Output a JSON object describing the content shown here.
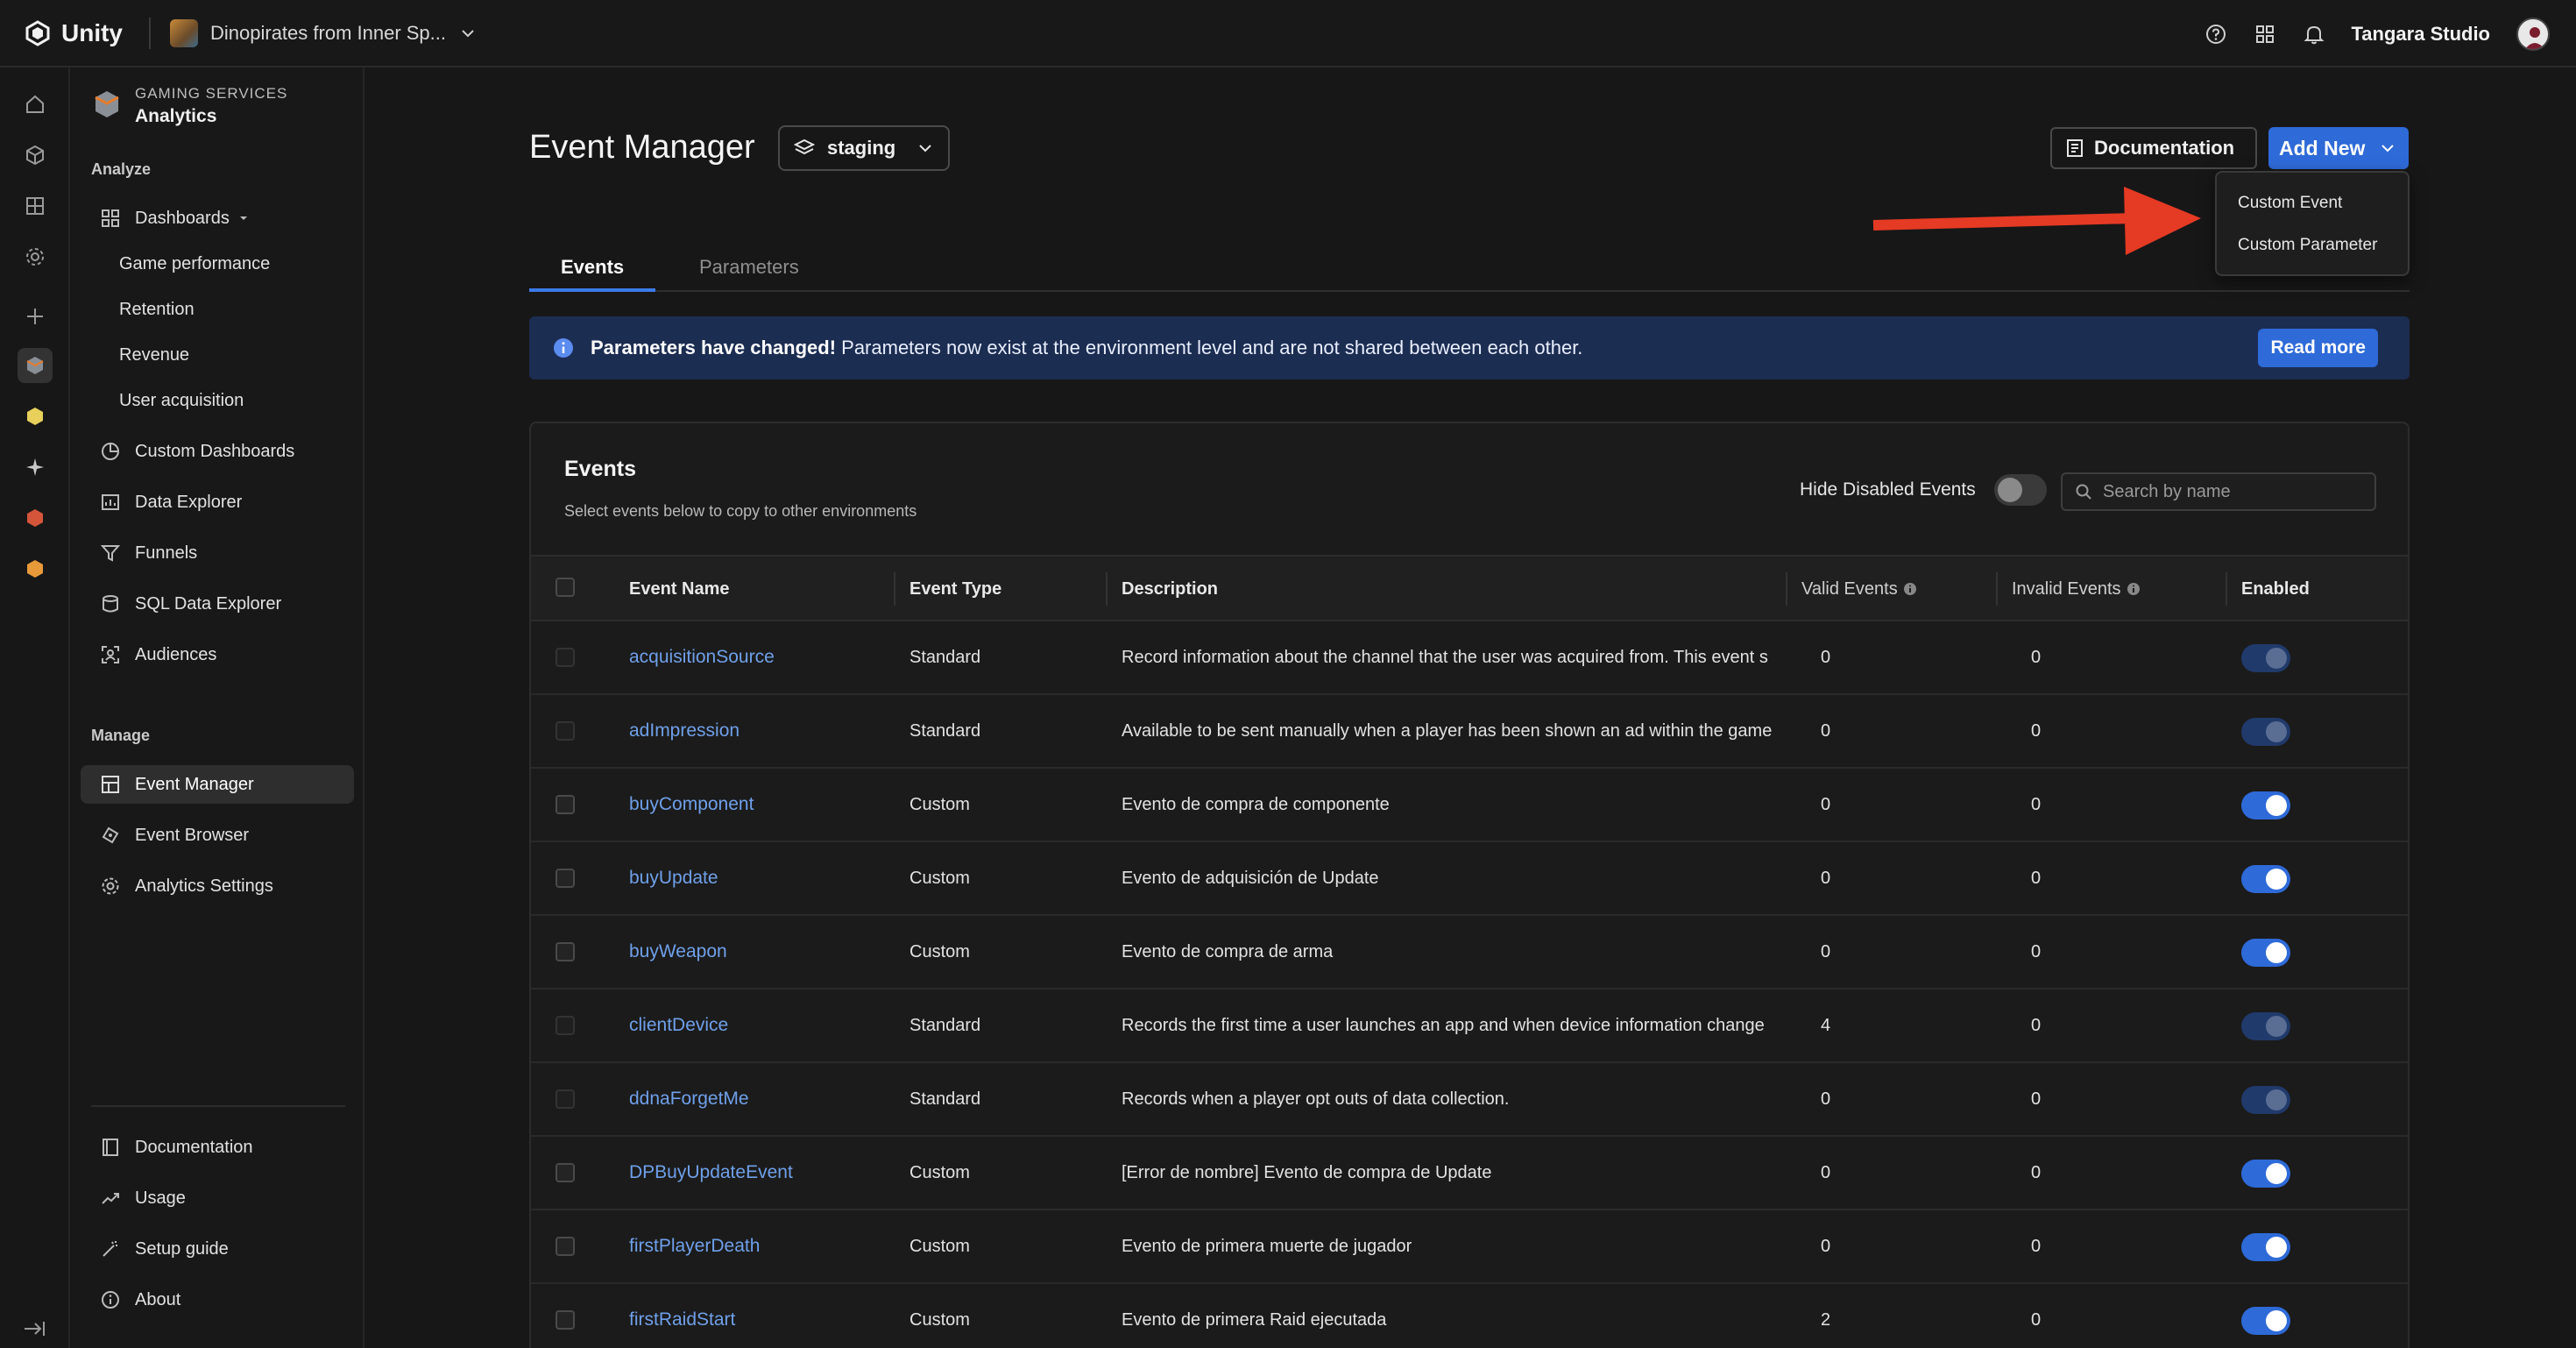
{
  "topbar": {
    "brand": "Unity",
    "project": "Dinopirates from Inner Sp...",
    "org": "Tangara Studio",
    "icons": [
      "help-icon",
      "apps-grid-icon",
      "bell-icon"
    ]
  },
  "sidebar": {
    "service_kicker": "GAMING SERVICES",
    "service_title": "Analytics",
    "analyze_label": "Analyze",
    "manage_label": "Manage",
    "dashboards": "Dashboards",
    "dashboard_items": [
      "Game performance",
      "Retention",
      "Revenue",
      "User acquisition"
    ],
    "analyze_items": [
      "Custom Dashboards",
      "Data Explorer",
      "Funnels",
      "SQL Data Explorer",
      "Audiences"
    ],
    "manage_items": [
      "Event Manager",
      "Event Browser",
      "Analytics Settings"
    ],
    "footer_items": [
      "Documentation",
      "Usage",
      "Setup guide",
      "About"
    ]
  },
  "header": {
    "title": "Event Manager",
    "environment": "staging",
    "documentation_label": "Documentation",
    "add_new_label": "Add New"
  },
  "add_menu": {
    "items": [
      "Custom Event",
      "Custom Parameter"
    ]
  },
  "tabs": [
    "Events",
    "Parameters"
  ],
  "banner": {
    "bold": "Parameters have changed!",
    "text": " Parameters now exist at the environment level and are not shared between each other.",
    "action": "Read more"
  },
  "events_card": {
    "title": "Events",
    "subtitle": "Select events below to copy to other environments",
    "hide_disabled_label": "Hide Disabled Events",
    "hide_disabled_on": false,
    "search_placeholder": "Search by name"
  },
  "table": {
    "columns": [
      "Event Name",
      "Event Type",
      "Description",
      "Valid Events",
      "Invalid Events",
      "Enabled"
    ],
    "rows": [
      {
        "name": "acquisitionSource",
        "type": "Standard",
        "description": "Record information about the channel that the user was acquired from. This event s",
        "valid": "0",
        "invalid": "0",
        "enabled": true,
        "locked": true
      },
      {
        "name": "adImpression",
        "type": "Standard",
        "description": "Available to be sent manually when a player has been shown an ad within the game",
        "valid": "0",
        "invalid": "0",
        "enabled": true,
        "locked": true
      },
      {
        "name": "buyComponent",
        "type": "Custom",
        "description": "Evento de compra de componente",
        "valid": "0",
        "invalid": "0",
        "enabled": true,
        "locked": false
      },
      {
        "name": "buyUpdate",
        "type": "Custom",
        "description": "Evento de adquisición de Update",
        "valid": "0",
        "invalid": "0",
        "enabled": true,
        "locked": false
      },
      {
        "name": "buyWeapon",
        "type": "Custom",
        "description": "Evento de compra de arma",
        "valid": "0",
        "invalid": "0",
        "enabled": true,
        "locked": false
      },
      {
        "name": "clientDevice",
        "type": "Standard",
        "description": "Records the first time a user launches an app and when device information change",
        "valid": "4",
        "invalid": "0",
        "enabled": true,
        "locked": true
      },
      {
        "name": "ddnaForgetMe",
        "type": "Standard",
        "description": "Records when a player opt outs of data collection.",
        "valid": "0",
        "invalid": "0",
        "enabled": true,
        "locked": true
      },
      {
        "name": "DPBuyUpdateEvent",
        "type": "Custom",
        "description": "[Error de nombre] Evento de compra de Update",
        "valid": "0",
        "invalid": "0",
        "enabled": true,
        "locked": false
      },
      {
        "name": "firstPlayerDeath",
        "type": "Custom",
        "description": "Evento de primera muerte de jugador",
        "valid": "0",
        "invalid": "0",
        "enabled": true,
        "locked": false
      },
      {
        "name": "firstRaidStart",
        "type": "Custom",
        "description": "Evento de primera Raid ejecutada",
        "valid": "2",
        "invalid": "0",
        "enabled": true,
        "locked": false
      }
    ]
  },
  "colors": {
    "accent": "#2e6ad8",
    "link": "#6fa0ea",
    "banner_bg": "#1c2d52",
    "annotation_arrow": "#e53a24"
  }
}
